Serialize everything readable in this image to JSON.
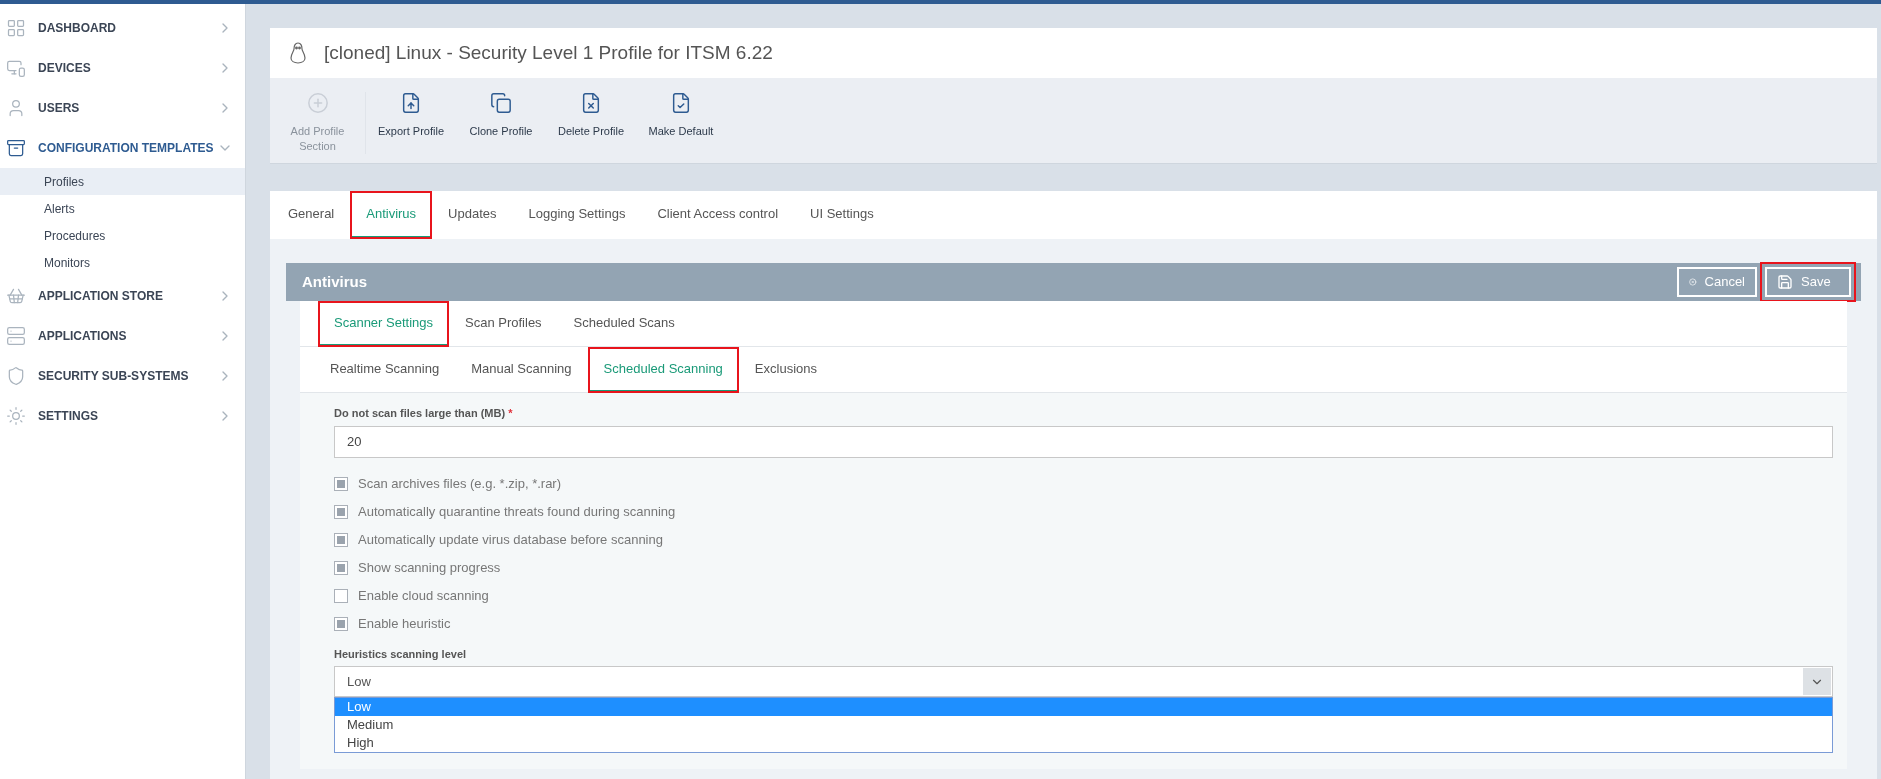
{
  "sidebar": {
    "items": [
      {
        "label": "DASHBOARD",
        "expanded": false
      },
      {
        "label": "DEVICES",
        "expanded": false
      },
      {
        "label": "USERS",
        "expanded": false
      },
      {
        "label": "CONFIGURATION TEMPLATES",
        "expanded": true,
        "children": [
          {
            "label": "Profiles",
            "selected": true
          },
          {
            "label": "Alerts",
            "selected": false
          },
          {
            "label": "Procedures",
            "selected": false
          },
          {
            "label": "Monitors",
            "selected": false
          }
        ]
      },
      {
        "label": "APPLICATION STORE",
        "expanded": false
      },
      {
        "label": "APPLICATIONS",
        "expanded": false
      },
      {
        "label": "SECURITY SUB-SYSTEMS",
        "expanded": false
      },
      {
        "label": "SETTINGS",
        "expanded": false
      }
    ]
  },
  "page": {
    "title": "[cloned] Linux - Security Level 1 Profile for ITSM 6.22"
  },
  "toolbar": [
    {
      "label": "Add Profile Section",
      "disabled": true
    },
    {
      "label": "Export Profile",
      "disabled": false
    },
    {
      "label": "Clone Profile",
      "disabled": false
    },
    {
      "label": "Delete Profile",
      "disabled": false
    },
    {
      "label": "Make Default",
      "disabled": false
    }
  ],
  "tabs": [
    {
      "label": "General",
      "selected": false,
      "highlighted": false
    },
    {
      "label": "Antivirus",
      "selected": true,
      "highlighted": true
    },
    {
      "label": "Updates",
      "selected": false,
      "highlighted": false
    },
    {
      "label": "Logging Settings",
      "selected": false,
      "highlighted": false
    },
    {
      "label": "Client Access control",
      "selected": false,
      "highlighted": false
    },
    {
      "label": "UI Settings",
      "selected": false,
      "highlighted": false
    }
  ],
  "section": {
    "title": "Antivirus",
    "buttons": [
      {
        "label": "Cancel",
        "highlighted": false
      },
      {
        "label": "Save",
        "highlighted": true
      }
    ]
  },
  "sub_tabs": [
    {
      "label": "Scanner Settings",
      "selected": true,
      "highlighted": true
    },
    {
      "label": "Scan Profiles",
      "selected": false,
      "highlighted": false
    },
    {
      "label": "Scheduled Scans",
      "selected": false,
      "highlighted": false
    }
  ],
  "scan_tabs": [
    {
      "label": "Realtime Scanning",
      "selected": false,
      "highlighted": false
    },
    {
      "label": "Manual Scanning",
      "selected": false,
      "highlighted": false
    },
    {
      "label": "Scheduled Scanning",
      "selected": true,
      "highlighted": true
    },
    {
      "label": "Exclusions",
      "selected": false,
      "highlighted": false
    }
  ],
  "form": {
    "size_field": {
      "label": "Do not scan files large than (MB)",
      "required_mark": "*",
      "value": "20"
    },
    "options": [
      {
        "label": "Scan archives files (e.g. *.zip, *.rar)",
        "checked": true
      },
      {
        "label": "Automatically quarantine threats found during scanning",
        "checked": true
      },
      {
        "label": "Automatically update virus database before scanning",
        "checked": true
      },
      {
        "label": "Show scanning progress",
        "checked": true
      },
      {
        "label": "Enable cloud scanning",
        "checked": false
      },
      {
        "label": "Enable heuristic",
        "checked": true
      }
    ],
    "level_select": {
      "label": "Heuristics scanning level",
      "value": "Low",
      "expanded": true,
      "options": [
        {
          "label": "Low",
          "selected": true
        },
        {
          "label": "Medium",
          "selected": false
        },
        {
          "label": "High",
          "selected": false
        }
      ]
    }
  }
}
